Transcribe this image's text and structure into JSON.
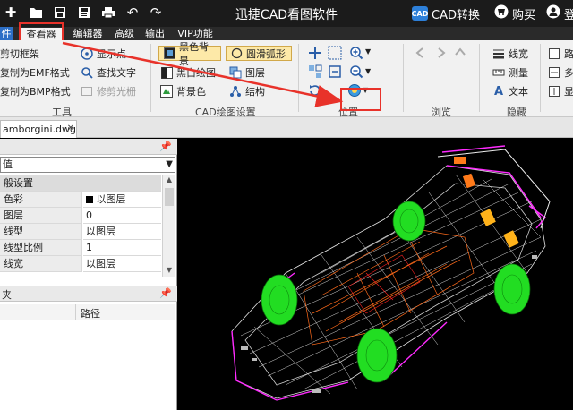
{
  "window": {
    "title": "迅捷CAD看图软件",
    "cad_convert_label": "CAD转换",
    "cad_badge": "CAD",
    "buy_label": "购买",
    "login_label": "登"
  },
  "menu": {
    "tabs": [
      "件",
      "查看器",
      "编辑器",
      "高级",
      "输出",
      "VIP功能"
    ]
  },
  "ribbon": {
    "tools": {
      "items": [
        "剪切框架",
        "复制为EMF格式",
        "复制为BMP格式"
      ],
      "col2": [
        "显示点",
        "查找文字",
        "修剪光栅"
      ],
      "label": "工具"
    },
    "cad_settings": {
      "black_bg": "黑色背景",
      "smooth_arc": "圆滑弧形",
      "bw_draw": "黑白绘图",
      "layer": "图层",
      "bg_color": "背景色",
      "structure": "结构",
      "label": "CAD绘图设置"
    },
    "position": {
      "label": "位置"
    },
    "browse": {
      "label": "浏览"
    },
    "hide": {
      "line_width": "线宽",
      "measure": "测量",
      "text": "文本",
      "label": "隐藏"
    },
    "extra": {
      "labels": [
        "路",
        "多",
        "显"
      ]
    }
  },
  "document": {
    "tab_label": "amborgini.dwg"
  },
  "properties": {
    "combo_value": "值",
    "section_label": "般设置",
    "rows": [
      {
        "key": "色彩",
        "value": "以图层"
      },
      {
        "key": "图层",
        "value": "0"
      },
      {
        "key": "线型",
        "value": "以图层"
      },
      {
        "key": "线型比例",
        "value": "1"
      },
      {
        "key": "线宽",
        "value": "以图层"
      }
    ],
    "list_panel_title": "夹",
    "list_column_path": "路径"
  },
  "colors": {
    "title_bar": "#1b1b1b",
    "ribbon_bg": "#f1f1f1",
    "highlight_box": "#e8322a",
    "canvas_bg": "#000000",
    "wheel_green": "#22dd22",
    "magenta": "#ff2bff",
    "orange": "#ff7a1a"
  }
}
